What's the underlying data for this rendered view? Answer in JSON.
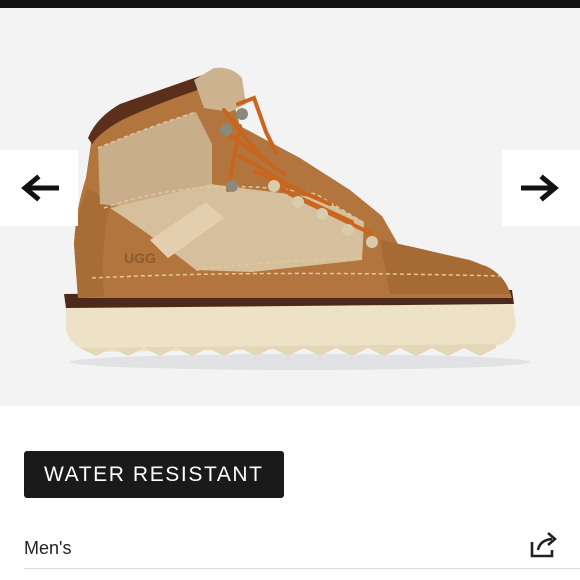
{
  "gallery": {
    "prev_icon": "arrow-left-icon",
    "next_icon": "arrow-right-icon",
    "image_subject": "boot",
    "logo_text": "UGG",
    "background": "#f3f3f4"
  },
  "badge": {
    "label": "WATER RESISTANT",
    "background": "#1a1a1a",
    "color": "#ffffff"
  },
  "category": {
    "label": "Men's"
  },
  "share": {
    "icon": "share-icon"
  }
}
